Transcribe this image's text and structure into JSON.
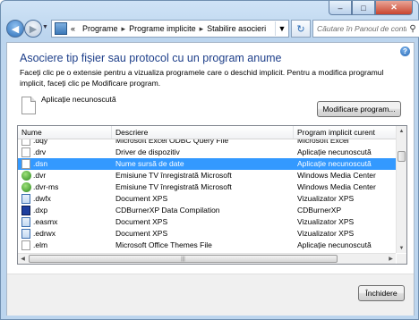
{
  "window": {
    "controls": {
      "minimize": "–",
      "maximize": "□",
      "close": "✕"
    }
  },
  "nav": {
    "address": {
      "overflow": "«",
      "crumbs": [
        "Programe",
        "Programe implicite",
        "Stabilire asocieri"
      ]
    },
    "search_placeholder": "Căutare în Panoul de control"
  },
  "content": {
    "heading": "Asociere tip fișier sau protocol cu un program anume",
    "description": "Faceți clic pe o extensie pentru a vizualiza programele care o deschid implicit. Pentru a modifica programul implicit, faceți clic pe Modificare program.",
    "current_program": "Aplicație necunoscută",
    "change_button": "Modificare program...",
    "close_button": "Închidere"
  },
  "table": {
    "columns": [
      "Nume",
      "Descriere",
      "Program implicit curent"
    ],
    "rows": [
      {
        "icon": "doc",
        "name": ".dqy",
        "desc": "Microsoft Excel ODBC Query File",
        "prog": "Microsoft Excel"
      },
      {
        "icon": "doc",
        "name": ".drv",
        "desc": "Driver de dispozitiv",
        "prog": "Aplicație necunoscută"
      },
      {
        "icon": "doc",
        "name": ".dsn",
        "desc": "Nume sursă de date",
        "prog": "Aplicație necunoscută",
        "selected": true
      },
      {
        "icon": "wmc",
        "name": ".dvr",
        "desc": "Emisiune TV înregistrată Microsoft",
        "prog": "Windows Media Center"
      },
      {
        "icon": "wmc",
        "name": ".dvr-ms",
        "desc": "Emisiune TV înregistrată Microsoft",
        "prog": "Windows Media Center"
      },
      {
        "icon": "xps",
        "name": ".dwfx",
        "desc": "Document XPS",
        "prog": "Vizualizator XPS"
      },
      {
        "icon": "cdb",
        "name": ".dxp",
        "desc": "CDBurnerXP Data Compilation",
        "prog": "CDBurnerXP"
      },
      {
        "icon": "xps",
        "name": ".easmx",
        "desc": "Document XPS",
        "prog": "Vizualizator XPS"
      },
      {
        "icon": "xps",
        "name": ".edrwx",
        "desc": "Document XPS",
        "prog": "Vizualizator XPS"
      },
      {
        "icon": "doc",
        "name": ".elm",
        "desc": "Microsoft Office Themes File",
        "prog": "Aplicație necunoscută"
      }
    ]
  },
  "icons": {
    "back": "back-arrow-icon",
    "forward": "forward-arrow-icon",
    "refresh": "refresh-icon",
    "search": "search-icon",
    "help": "help-icon"
  }
}
